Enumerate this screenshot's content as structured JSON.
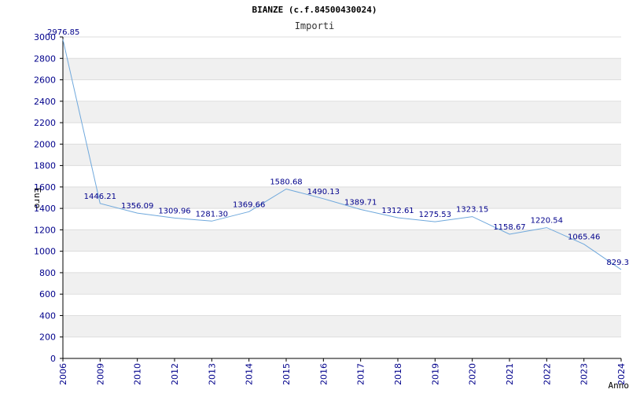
{
  "colors": {
    "line": "#6fa8dc",
    "band": "#f0f0f0",
    "grid": "#dddddd",
    "axis": "#000000",
    "text": "#00008b"
  },
  "chart_data": {
    "type": "line",
    "title": "BIANZE (c.f.84500430024)",
    "subtitle": "Importi",
    "ylabel": "Euro",
    "xlabel": "Anno",
    "ylim": [
      0,
      3000
    ],
    "yticks": [
      0,
      200,
      400,
      600,
      800,
      1000,
      1200,
      1400,
      1600,
      1800,
      2000,
      2200,
      2400,
      2600,
      2800,
      3000
    ],
    "grid": "horizontal alternating bands",
    "categories": [
      "2006",
      "2009",
      "2010",
      "2012",
      "2013",
      "2014",
      "2015",
      "2016",
      "2017",
      "2018",
      "2019",
      "2020",
      "2021",
      "2022",
      "2023",
      "2024"
    ],
    "values": [
      2976.85,
      1446.21,
      1356.09,
      1309.96,
      1281.3,
      1369.66,
      1580.68,
      1490.13,
      1389.71,
      1312.61,
      1275.53,
      1323.15,
      1158.67,
      1220.54,
      1065.46,
      829.3
    ],
    "value_labels": [
      "2976.85",
      "1446.21",
      "1356.09",
      "1309.96",
      "1281.30",
      "1369.66",
      "1580.68",
      "1490.13",
      "1389.71",
      "1312.61",
      "1275.53",
      "1323.15",
      "1158.67",
      "1220.54",
      "1065.46",
      "829.3"
    ]
  }
}
